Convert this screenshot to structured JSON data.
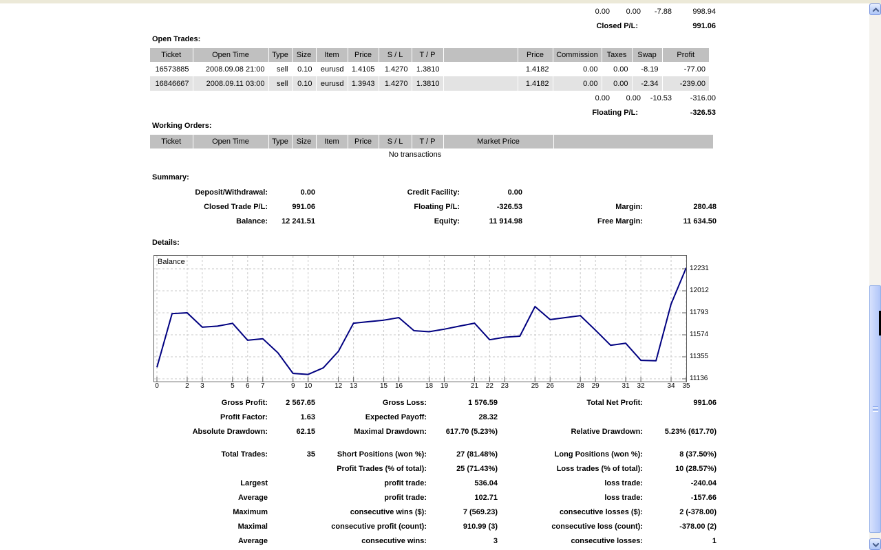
{
  "closed_section": {
    "totals": [
      "0.00",
      "0.00",
      "-7.88",
      "998.94"
    ],
    "label": "Closed P/L:",
    "value": "991.06"
  },
  "open_trades": {
    "section_label": "Open Trades:",
    "headers": [
      "Ticket",
      "Open Time",
      "Type",
      "Size",
      "Item",
      "Price",
      "S / L",
      "T / P",
      "",
      "Price",
      "Commission",
      "Taxes",
      "Swap",
      "Profit"
    ],
    "rows": [
      [
        "16573885",
        "2008.09.08 21:00",
        "sell",
        "0.10",
        "eurusd",
        "1.4105",
        "1.4270",
        "1.3810",
        "",
        "1.4182",
        "0.00",
        "0.00",
        "-8.19",
        "-77.00"
      ],
      [
        "16846667",
        "2008.09.11 03:00",
        "sell",
        "0.10",
        "eurusd",
        "1.3943",
        "1.4270",
        "1.3810",
        "",
        "1.4182",
        "0.00",
        "0.00",
        "-2.34",
        "-239.00"
      ]
    ],
    "totals": [
      "0.00",
      "0.00",
      "-10.53",
      "-316.00"
    ],
    "floating_label": "Floating P/L:",
    "floating_value": "-326.53"
  },
  "working_orders": {
    "section_label": "Working Orders:",
    "headers": [
      "Ticket",
      "Open Time",
      "Type",
      "Size",
      "Item",
      "Price",
      "S / L",
      "T / P",
      "Market Price",
      ""
    ],
    "empty_text": "No transactions"
  },
  "summary": {
    "section_label": "Summary:",
    "rows": [
      [
        [
          "Deposit/Withdrawal:",
          "0.00"
        ],
        [
          "Credit Facility:",
          "0.00"
        ],
        [
          "",
          ""
        ]
      ],
      [
        [
          "Closed Trade P/L:",
          "991.06"
        ],
        [
          "Floating P/L:",
          "-326.53"
        ],
        [
          "Margin:",
          "280.48"
        ]
      ],
      [
        [
          "Balance:",
          "12 241.51"
        ],
        [
          "Equity:",
          "11 914.98"
        ],
        [
          "Free Margin:",
          "11 634.50"
        ]
      ]
    ]
  },
  "details": {
    "section_label": "Details:"
  },
  "results": {
    "rows": [
      [
        [
          "Gross Profit:",
          "2 567.65"
        ],
        [
          "Gross Loss:",
          "1 576.59"
        ],
        [
          "Total Net Profit:",
          "991.06"
        ]
      ],
      [
        [
          "Profit Factor:",
          "1.63"
        ],
        [
          "Expected Payoff:",
          "28.32"
        ],
        [
          "",
          ""
        ]
      ],
      [
        [
          "Absolute Drawdown:",
          "62.15"
        ],
        [
          "Maximal Drawdown:",
          "617.70 (5.23%)"
        ],
        [
          "Relative Drawdown:",
          "5.23% (617.70)"
        ]
      ]
    ]
  },
  "trade_stats": {
    "rows": [
      [
        [
          "Total Trades:",
          "35"
        ],
        [
          "Short Positions (won %):",
          "27 (81.48%)"
        ],
        [
          "Long Positions (won %):",
          "8 (37.50%)"
        ]
      ],
      [
        [
          "",
          ""
        ],
        [
          "Profit Trades (% of total):",
          "25 (71.43%)"
        ],
        [
          "Loss trades (% of total):",
          "10 (28.57%)"
        ]
      ],
      [
        [
          "Largest",
          ""
        ],
        [
          "profit trade:",
          "536.04"
        ],
        [
          "loss trade:",
          "-240.04"
        ]
      ],
      [
        [
          "Average",
          ""
        ],
        [
          "profit trade:",
          "102.71"
        ],
        [
          "loss trade:",
          "-157.66"
        ]
      ],
      [
        [
          "Maximum",
          ""
        ],
        [
          "consecutive wins ($):",
          "7 (569.23)"
        ],
        [
          "consecutive losses ($):",
          "2 (-378.00)"
        ]
      ],
      [
        [
          "Maximal",
          ""
        ],
        [
          "consecutive profit (count):",
          "910.99 (3)"
        ],
        [
          "consecutive loss (count):",
          "-378.00 (2)"
        ]
      ],
      [
        [
          "Average",
          ""
        ],
        [
          "consecutive wins:",
          "3"
        ],
        [
          "consecutive losses:",
          "1"
        ]
      ]
    ]
  },
  "chart_data": {
    "type": "line",
    "title": "Balance",
    "xlabel": "",
    "ylabel": "",
    "x": [
      0,
      1,
      2,
      3,
      4,
      5,
      6,
      7,
      8,
      9,
      10,
      11,
      12,
      13,
      14,
      15,
      16,
      17,
      18,
      19,
      20,
      21,
      22,
      23,
      24,
      25,
      26,
      27,
      28,
      29,
      30,
      31,
      32,
      33,
      34,
      35
    ],
    "series": [
      {
        "name": "Balance",
        "values": [
          11250,
          11785,
          11793,
          11650,
          11660,
          11688,
          11520,
          11535,
          11395,
          11190,
          11180,
          11245,
          11410,
          11690,
          11705,
          11720,
          11745,
          11615,
          11605,
          11630,
          11660,
          11690,
          11525,
          11550,
          11560,
          11855,
          11725,
          11745,
          11765,
          11620,
          11470,
          11490,
          11320,
          11315,
          11880,
          12241
        ]
      }
    ],
    "x_tick_labels": [
      0,
      2,
      3,
      5,
      6,
      7,
      9,
      10,
      12,
      13,
      15,
      16,
      18,
      19,
      21,
      22,
      23,
      25,
      26,
      28,
      29,
      31,
      32,
      34,
      35
    ],
    "y_tick_labels": [
      12231,
      12012,
      11793,
      11574,
      11355,
      11136
    ],
    "ylim": [
      11109,
      12361
    ],
    "grid": "dashed",
    "legend_position": "none",
    "line_color": "#000080",
    "grid_color": "#c9c9c9"
  },
  "colors": {
    "table_header_bg": "#c0c0c0",
    "table_alt_row_bg": "#e3e3e3",
    "top_strip": "#ece9d8",
    "chart_line": "#000080"
  }
}
